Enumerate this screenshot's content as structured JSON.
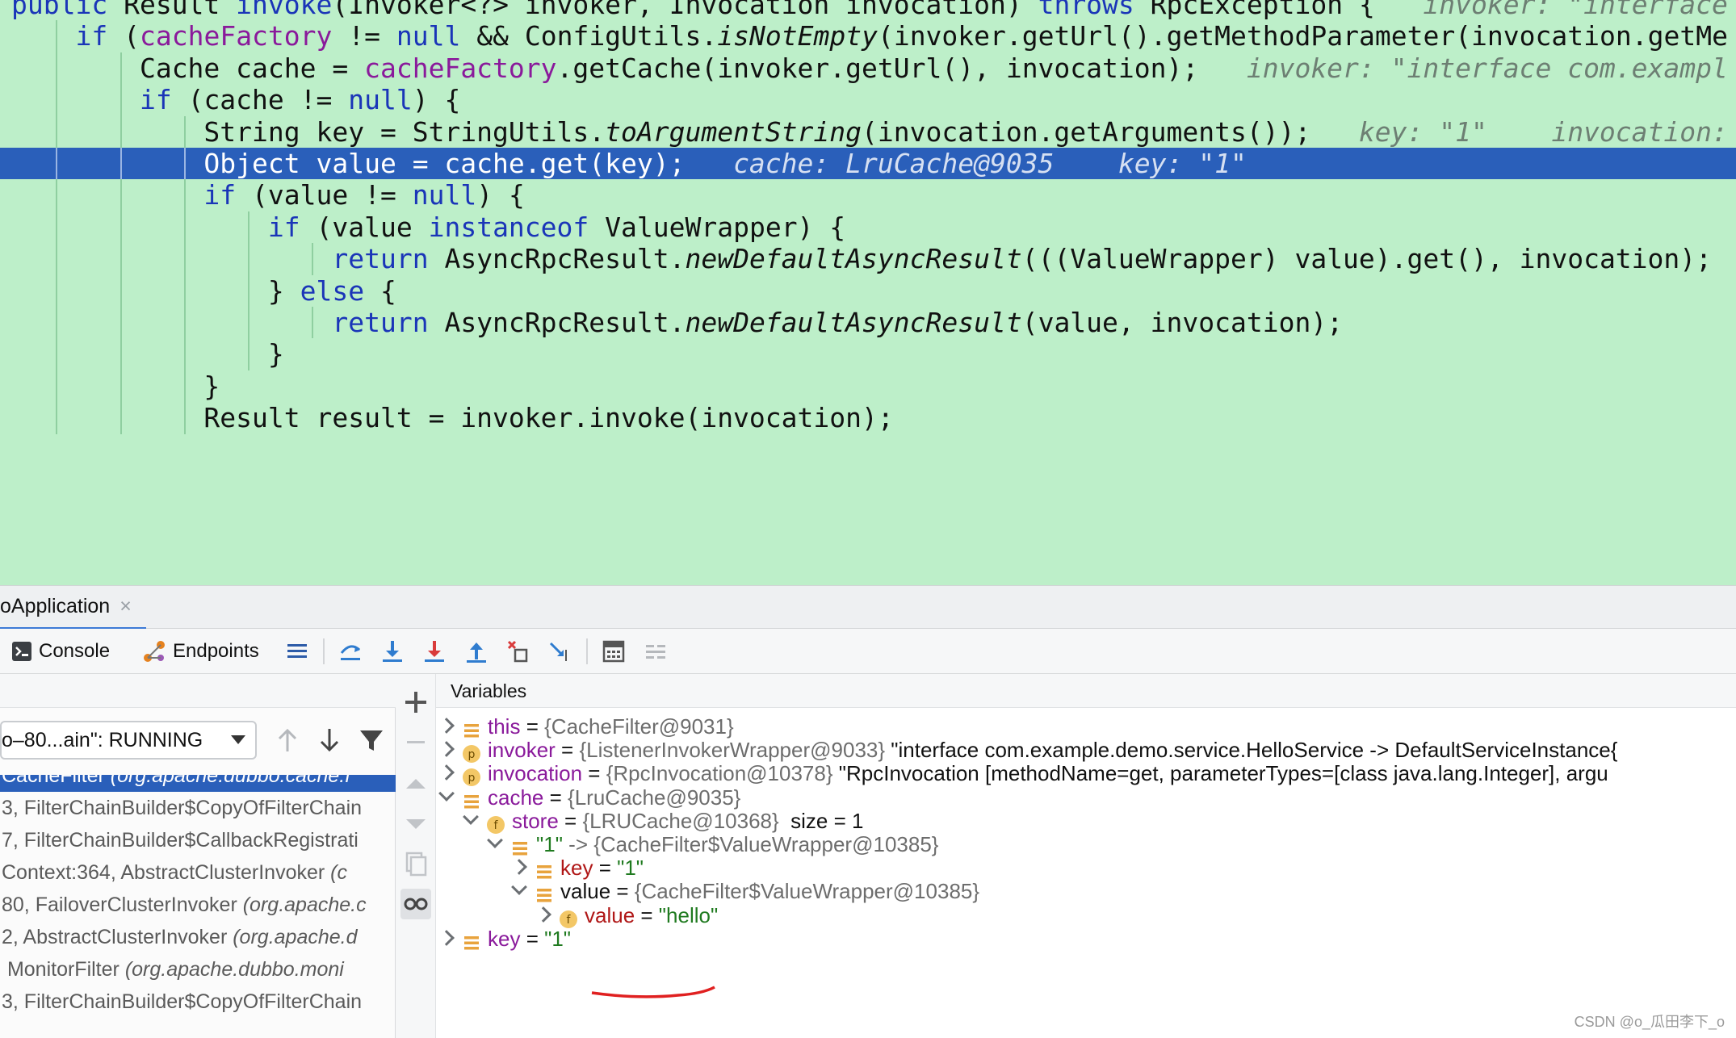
{
  "editor": {
    "lines": [
      {
        "indent": "",
        "parts": [
          {
            "t": "public",
            "c": "kw"
          },
          {
            "t": " Result "
          },
          {
            "t": "invoke",
            "c": "kw"
          },
          {
            "t": "(Invoker<?> invoker, Invocation invocation) "
          },
          {
            "t": "throws",
            "c": "kw"
          },
          {
            "t": " RpcException {   "
          },
          {
            "t": "invoker: \"interface",
            "c": "hint"
          }
        ]
      },
      {
        "indent": "    ",
        "parts": [
          {
            "t": "if",
            "c": "kw"
          },
          {
            "t": " ("
          },
          {
            "t": "cacheFactory",
            "c": "fld"
          },
          {
            "t": " != "
          },
          {
            "t": "null",
            "c": "kw"
          },
          {
            "t": " && ConfigUtils."
          },
          {
            "t": "isNotEmpty",
            "c": "it"
          },
          {
            "t": "(invoker.getUrl().getMethodParameter(invocation.getMe"
          }
        ]
      },
      {
        "indent": "        ",
        "parts": [
          {
            "t": "Cache cache = "
          },
          {
            "t": "cacheFactory",
            "c": "fld"
          },
          {
            "t": ".getCache(invoker.getUrl(), invocation);   "
          },
          {
            "t": "invoker: \"interface com.exampl",
            "c": "hint"
          }
        ]
      },
      {
        "indent": "        ",
        "parts": [
          {
            "t": "if",
            "c": "kw"
          },
          {
            "t": " (cache != "
          },
          {
            "t": "null",
            "c": "kw"
          },
          {
            "t": ") {"
          }
        ]
      },
      {
        "indent": "            ",
        "parts": [
          {
            "t": "String key = StringUtils."
          },
          {
            "t": "toArgumentString",
            "c": "it"
          },
          {
            "t": "(invocation.getArguments());   "
          },
          {
            "t": "key: \"1\"    invocation: ",
            "c": "hint"
          }
        ]
      },
      {
        "indent": "            ",
        "current": true,
        "parts": [
          {
            "t": "Object value = cache.get(key);   "
          },
          {
            "t": "cache: LruCache@9035    key: \"1\"",
            "c": "hint"
          }
        ]
      },
      {
        "indent": "            ",
        "parts": [
          {
            "t": "if",
            "c": "kw"
          },
          {
            "t": " (value != "
          },
          {
            "t": "null",
            "c": "kw"
          },
          {
            "t": ") {"
          }
        ]
      },
      {
        "indent": "                ",
        "parts": [
          {
            "t": "if",
            "c": "kw"
          },
          {
            "t": " (value "
          },
          {
            "t": "instanceof",
            "c": "kw"
          },
          {
            "t": " ValueWrapper) {"
          }
        ]
      },
      {
        "indent": "                    ",
        "parts": [
          {
            "t": "return",
            "c": "kw"
          },
          {
            "t": " AsyncRpcResult."
          },
          {
            "t": "newDefaultAsyncResult",
            "c": "it"
          },
          {
            "t": "(((ValueWrapper) value).get(), invocation);"
          }
        ]
      },
      {
        "indent": "                ",
        "parts": [
          {
            "t": "} "
          },
          {
            "t": "else",
            "c": "kw"
          },
          {
            "t": " {"
          }
        ]
      },
      {
        "indent": "                    ",
        "parts": [
          {
            "t": "return",
            "c": "kw"
          },
          {
            "t": " AsyncRpcResult."
          },
          {
            "t": "newDefaultAsyncResult",
            "c": "it"
          },
          {
            "t": "(value, invocation);"
          }
        ]
      },
      {
        "indent": "                ",
        "parts": [
          {
            "t": "}"
          }
        ]
      },
      {
        "indent": "            ",
        "parts": [
          {
            "t": "}"
          }
        ]
      },
      {
        "indent": "            ",
        "parts": [
          {
            "t": "Result result = invoker.invoke(invocation);"
          }
        ]
      }
    ]
  },
  "session": {
    "tab_label": "oApplication",
    "close_glyph": "×"
  },
  "toolbar": {
    "console_label": "Console",
    "endpoints_label": "Endpoints"
  },
  "frames": {
    "thread_label": "o–80...ain\": RUNNING",
    "items": [
      {
        "method": "CacheFilter ",
        "cls": "(org.apache.dubbo.cache.f",
        "active": true
      },
      {
        "method": "3, FilterChainBuilder$CopyOfFilterChain",
        "cls": ""
      },
      {
        "method": "7, FilterChainBuilder$CallbackRegistrati",
        "cls": ""
      },
      {
        "method": "Context:364, AbstractClusterInvoker ",
        "cls": "(c"
      },
      {
        "method": "80, FailoverClusterInvoker ",
        "cls": "(org.apache.c"
      },
      {
        "method": "2, AbstractClusterInvoker ",
        "cls": "(org.apache.d"
      },
      {
        "method": " MonitorFilter ",
        "cls": "(org.apache.dubbo.moni"
      },
      {
        "method": "3, FilterChainBuilder$CopyOfFilterChain",
        "cls": ""
      }
    ]
  },
  "variables": {
    "header": "Variables",
    "rows": [
      {
        "depth": 0,
        "chev": "right",
        "icon": "field-icon",
        "name": "this",
        "nameStyle": "fld",
        "type": "{CacheFilter@9031}",
        "desc": ""
      },
      {
        "depth": 0,
        "chev": "right",
        "icon": "parameter-icon",
        "name": "invoker",
        "nameStyle": "fld",
        "type": "{ListenerInvokerWrapper@9033}",
        "desc": " \"interface com.example.demo.service.HelloService -> DefaultServiceInstance{"
      },
      {
        "depth": 0,
        "chev": "right",
        "icon": "parameter-icon",
        "name": "invocation",
        "nameStyle": "fld",
        "type": "{RpcInvocation@10378}",
        "desc": " \"RpcInvocation [methodName=get, parameterTypes=[class java.lang.Integer], argu"
      },
      {
        "depth": 0,
        "chev": "down",
        "icon": "field-icon",
        "name": "cache",
        "nameStyle": "fld",
        "type": "{LruCache@9035}",
        "desc": ""
      },
      {
        "depth": 1,
        "chev": "down",
        "icon": "final-field-icon",
        "name": "store",
        "nameStyle": "fld",
        "type": "{LRUCache@10368}",
        "desc": "  size = 1"
      },
      {
        "depth": 2,
        "chev": "down",
        "icon": "field-icon",
        "name": "\"1\"",
        "nameStyle": "str",
        "type": "-> {CacheFilter$ValueWrapper@10385}",
        "desc": ""
      },
      {
        "depth": 3,
        "chev": "right",
        "icon": "field-icon",
        "name": "key",
        "nameStyle": "red",
        "value": "\"1\"",
        "type": "",
        "desc": ""
      },
      {
        "depth": 3,
        "chev": "down",
        "icon": "field-icon",
        "name": "value",
        "nameStyle": "plain",
        "type": "{CacheFilter$ValueWrapper@10385}",
        "desc": ""
      },
      {
        "depth": 4,
        "chev": "right",
        "icon": "final-field-icon",
        "name": "value",
        "nameStyle": "red",
        "value": "\"hello\"",
        "type": "",
        "desc": ""
      },
      {
        "depth": 0,
        "chev": "right",
        "icon": "field-icon",
        "name": "key",
        "nameStyle": "fld",
        "value": "\"1\"",
        "type": "",
        "desc": ""
      }
    ]
  },
  "watermark": "CSDN @o_瓜田李下_o",
  "colors": {
    "editor_bg": "#bdefc9",
    "current_line": "#2a5fba",
    "keyword": "#1a35b8",
    "field": "#8a1a9b",
    "annotation_red": "#e02020"
  }
}
